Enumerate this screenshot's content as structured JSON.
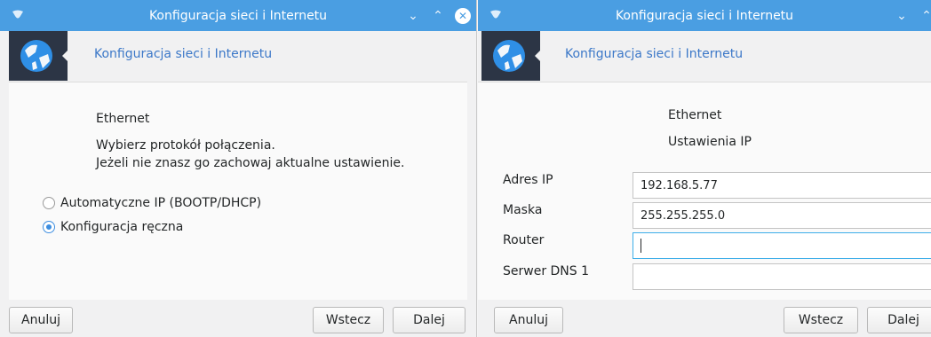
{
  "left": {
    "window_title": "Konfiguracja sieci i Internetu",
    "header_title": "Konfiguracja sieci i Internetu",
    "section": "Ethernet",
    "instruction_line1": "Wybierz protokół połączenia.",
    "instruction_line2": "Jeżeli nie znasz go zachowaj aktualne ustawienie.",
    "options": [
      {
        "label": "Automatyczne IP (BOOTP/DHCP)",
        "selected": false
      },
      {
        "label": "Konfiguracja ręczna",
        "selected": true
      }
    ],
    "buttons": {
      "cancel": "Anuluj",
      "back": "Wstecz",
      "next": "Dalej"
    }
  },
  "right": {
    "window_title": "Konfiguracja sieci i Internetu",
    "header_title": "Konfiguracja sieci i Internetu",
    "section": "Ethernet",
    "subsection": "Ustawienia IP",
    "fields": {
      "ip": {
        "label": "Adres IP",
        "value": "192.168.5.77"
      },
      "mask": {
        "label": "Maska",
        "value": "255.255.255.0"
      },
      "router": {
        "label": "Router",
        "value": ""
      },
      "dns1": {
        "label": "Serwer DNS 1",
        "value": ""
      }
    },
    "buttons": {
      "cancel": "Anuluj",
      "back": "Wstecz",
      "next": "Dalej"
    }
  },
  "colors": {
    "titlebar": "#4a9ee2",
    "accent": "#3d8ee0",
    "header_text": "#3c78c8",
    "logo_bg": "#2c3545"
  }
}
